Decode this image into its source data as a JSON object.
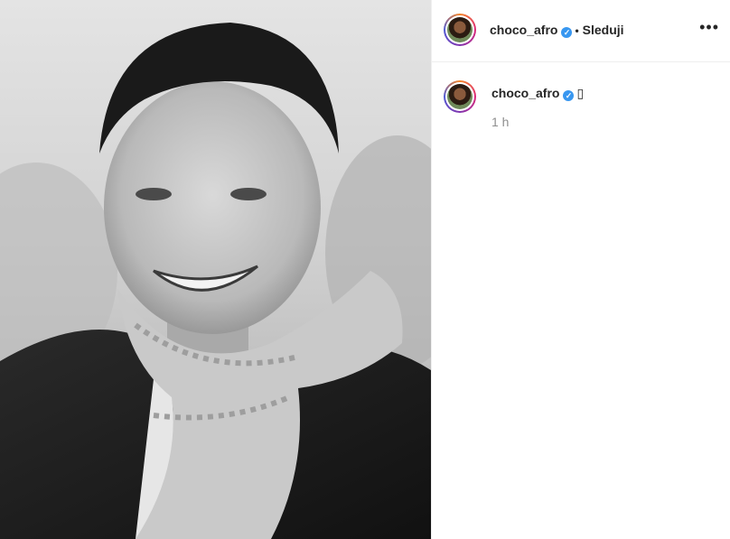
{
  "post": {
    "username": "choco_afro",
    "verified_icon": "verified-badge-icon",
    "separator": "•",
    "follow_label": "Sleduji",
    "more_icon": "more-options-icon",
    "more_label": "..."
  },
  "caption": {
    "username": "choco_afro",
    "text": "▯",
    "time": "1 h"
  },
  "colors": {
    "verified": "#3897f0",
    "muted": "#8e8e8e",
    "divider": "#efefef"
  }
}
